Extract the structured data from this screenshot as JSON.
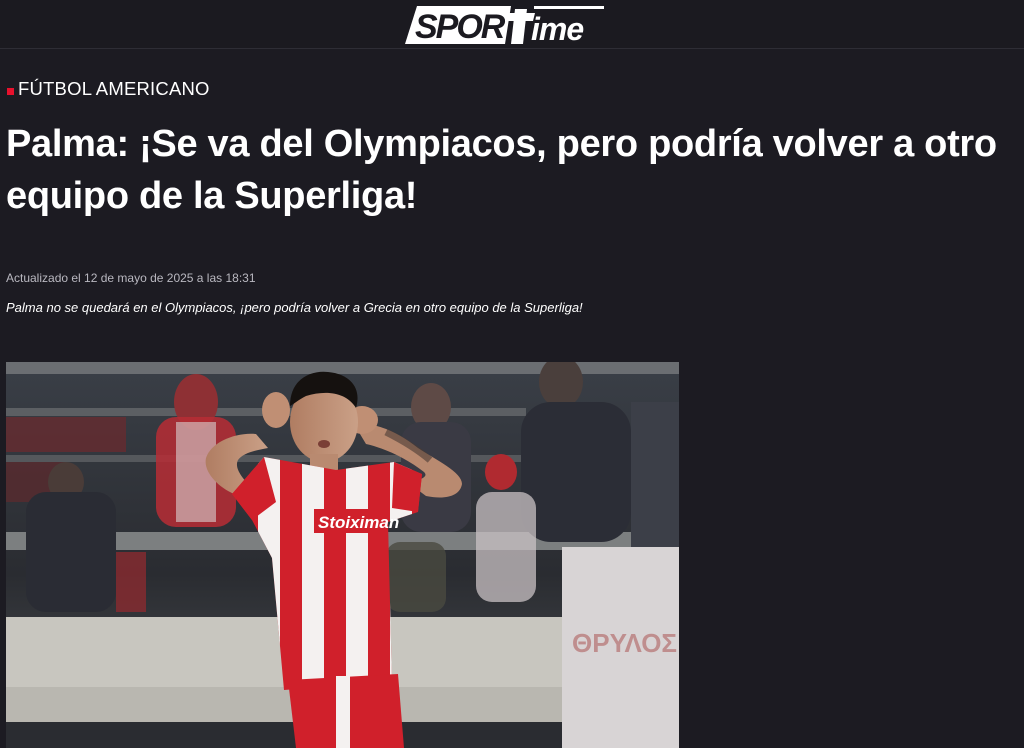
{
  "site": {
    "logo_text": "SPORTime"
  },
  "article": {
    "category": "FÚTBOL AMERICANO",
    "title": "Palma: ¡Se va del Olympiacos, pero podría volver a otro equipo de la Superliga!",
    "updated": "Actualizado el 12 de mayo de 2025 a las 18:31",
    "summary": "Palma no se quedará en el Olympiacos, ¡pero podría volver a Grecia en otro equipo de la Superliga!"
  },
  "photo": {
    "jersey_sponsor": "Stoiximan"
  },
  "colors": {
    "background": "#1c1b22",
    "accent": "#e8112d",
    "kit_red": "#d0202b"
  }
}
